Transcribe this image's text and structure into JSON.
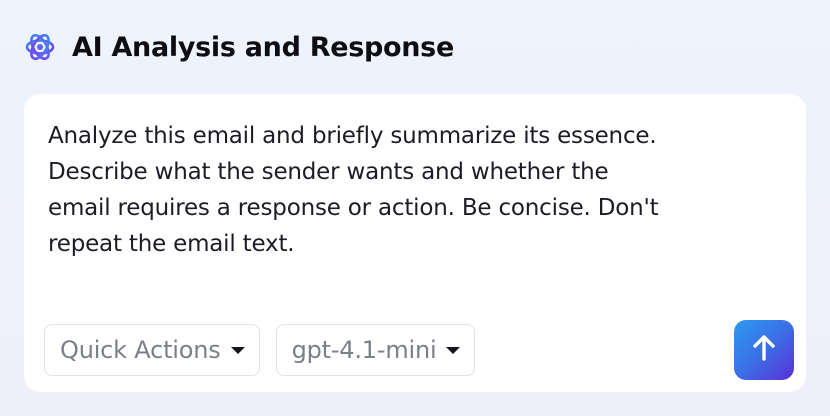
{
  "header": {
    "icon": "ai-sparkle-icon",
    "title": "AI Analysis and Response"
  },
  "prompt": {
    "text": "Analyze this email and briefly summarize its essence.\nDescribe what the sender wants and whether the\nemail requires a response or action. Be concise. Don't\nrepeat the email text."
  },
  "toolbar": {
    "quick_actions_label": "Quick Actions",
    "model_label": "gpt-4.1-mini",
    "send_icon": "arrow-up-icon"
  },
  "colors": {
    "accent_gradient_start": "#2e9bf0",
    "accent_gradient_end": "#5a2fd6",
    "icon_blue": "#3a7bf0",
    "icon_purple": "#7a3df0"
  }
}
